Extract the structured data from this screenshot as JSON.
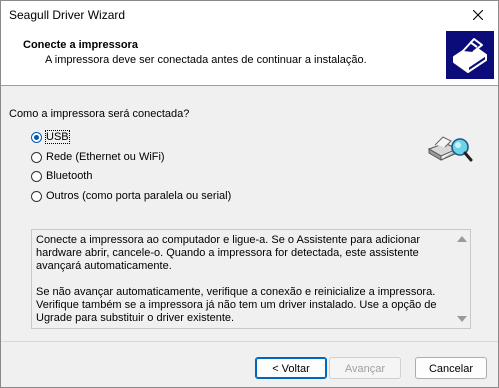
{
  "window": {
    "title": "Seagull Driver Wizard"
  },
  "header": {
    "title": "Conecte a impressora",
    "subtitle": "A impressora deve ser conectada antes de continuar a instalação.",
    "logo_icon": "printer-logo-icon"
  },
  "connection": {
    "question": "Como a impressora será conectada?",
    "options": [
      {
        "label": "USB",
        "checked": true
      },
      {
        "label": "Rede (Ethernet ou WiFi)",
        "checked": false
      },
      {
        "label": "Bluetooth",
        "checked": false
      },
      {
        "label": "Outros (como porta paralela ou serial)",
        "checked": false
      }
    ],
    "illustration_icon": "printer-search-icon"
  },
  "info": {
    "paragraph1": "Conecte a impressora ao computador e ligue-a. Se o Assistente para adicionar hardware abrir, cancele-o. Quando a impressora for detectada, este assistente avançará automaticamente.",
    "paragraph2": "Se não avançar automaticamente, verifique a conexão e reinicialize a impressora. Verifique também se a impressora já não tem um driver instalado. Use a opção de Ugrade para substituir o driver existente."
  },
  "buttons": {
    "back": "< Voltar",
    "next": "Avançar",
    "cancel": "Cancelar"
  },
  "colors": {
    "accent": "#0067c0",
    "logo_bg": "#0b0b7a"
  }
}
